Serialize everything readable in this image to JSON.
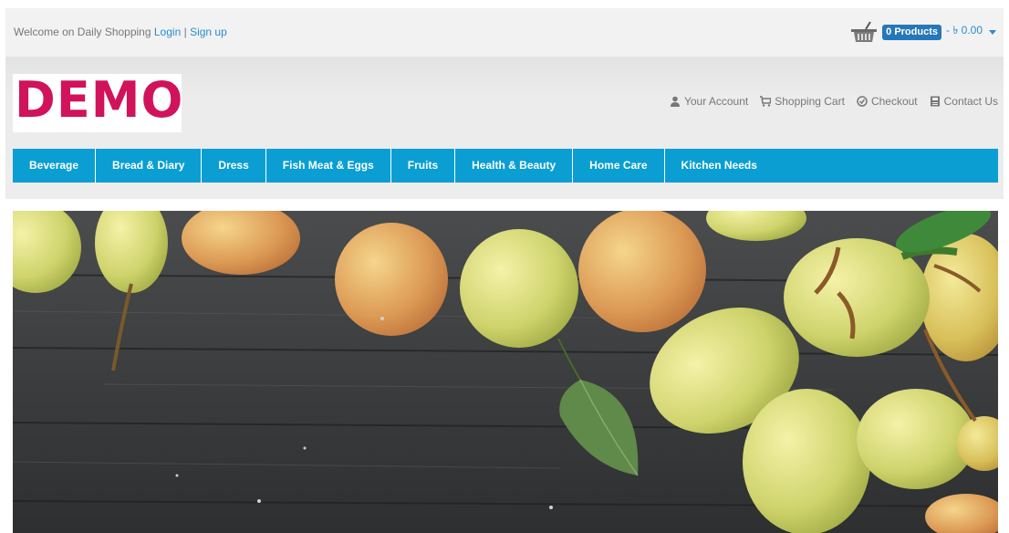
{
  "topbar": {
    "welcome_text": "Welcome on Daily Shopping",
    "login_label": "Login",
    "separator": "|",
    "signup_label": "Sign up",
    "cart_badge": "0 Products",
    "cart_total": "- ৳ 0.00",
    "cart_icon": "basket-icon"
  },
  "header": {
    "logo_text": "DEMO",
    "links": [
      {
        "label": "Your Account",
        "icon": "user-icon"
      },
      {
        "label": "Shopping Cart",
        "icon": "cart-icon"
      },
      {
        "label": "Checkout",
        "icon": "check-circle-icon"
      },
      {
        "label": "Contact Us",
        "icon": "contact-icon"
      }
    ]
  },
  "nav": {
    "items": [
      {
        "label": "Beverage"
      },
      {
        "label": "Bread & Diary"
      },
      {
        "label": "Dress"
      },
      {
        "label": "Fish Meat & Eggs"
      },
      {
        "label": "Fruits"
      },
      {
        "label": "Health & Beauty"
      },
      {
        "label": "Home Care"
      },
      {
        "label": "Kitchen Needs"
      }
    ]
  },
  "banner": {
    "subject": "pears-on-wood-banner"
  },
  "colors": {
    "nav_bg": "#0a9ed3",
    "badge_bg": "#2677b8",
    "link": "#2b8ccf",
    "logo": "#d0135a"
  }
}
